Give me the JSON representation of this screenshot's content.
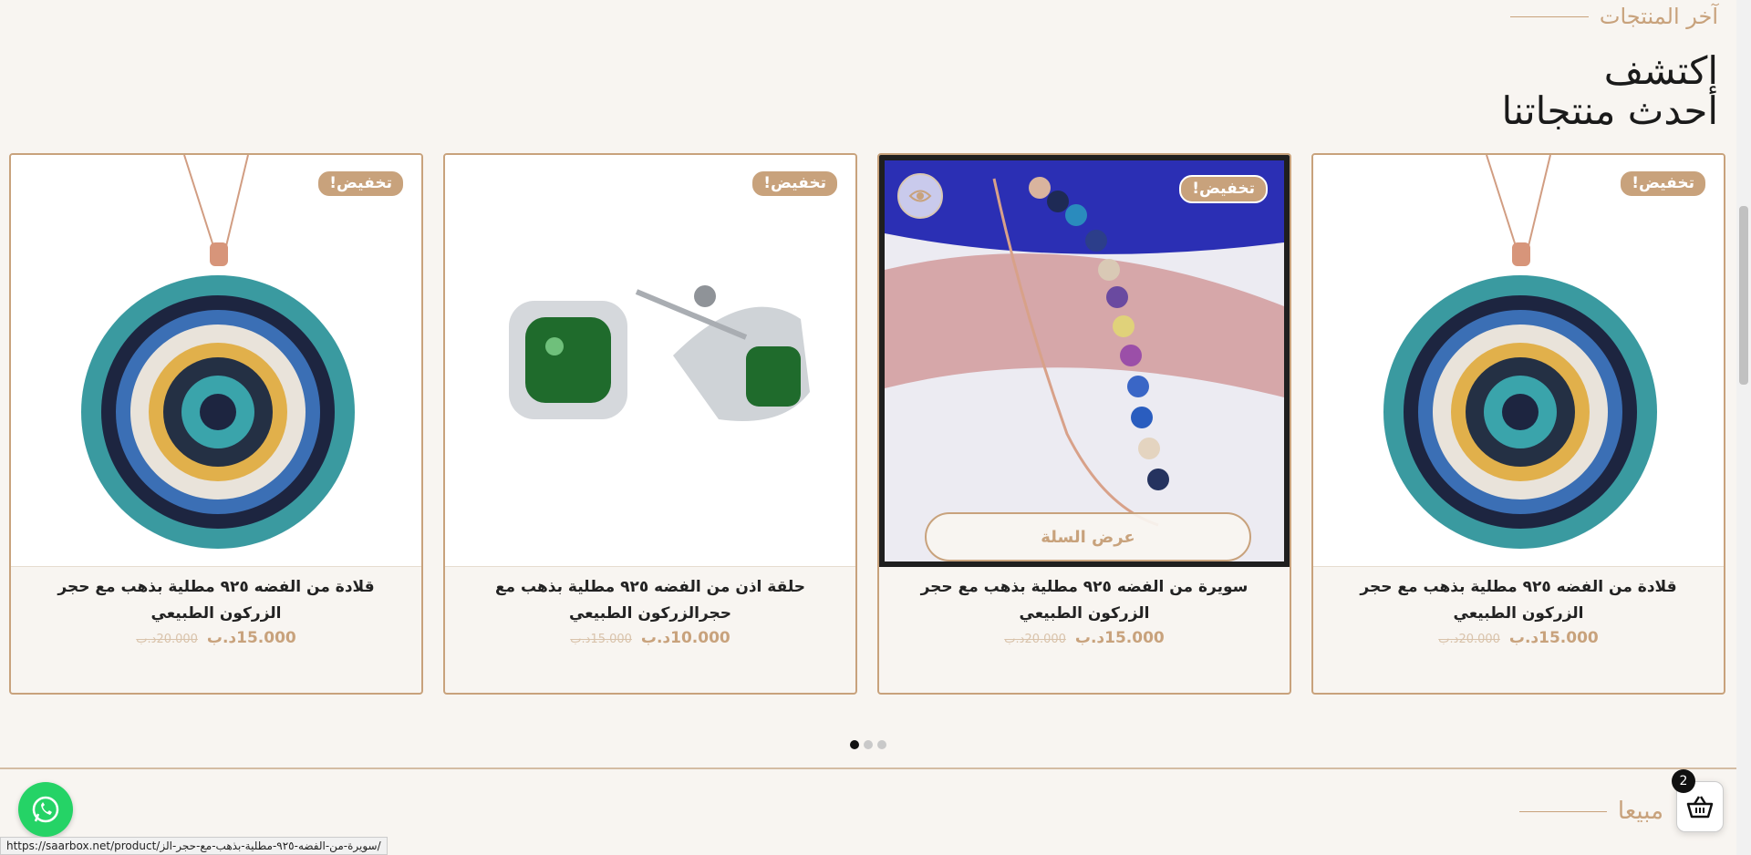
{
  "section": {
    "eyebrow": "آخر المنتجات",
    "headline_line1": "اكتشف",
    "headline_line2": "أحدث منتجاتنا"
  },
  "products": [
    {
      "title": "قلادة من الفضه ٩٢٥ مطلية بذهب مع حجر الزركون الطبيعي",
      "price": "15.000د.ب",
      "old_price": "20.000د.ب",
      "badge": "تخفيض!"
    },
    {
      "title": "حلقة اذن من الفضه ٩٢٥ مطلية بذهب مع حجرالزركون الطبيعي",
      "price": "10.000د.ب",
      "old_price": "15.000د.ب",
      "badge": "تخفيض!"
    },
    {
      "title": "سويرة من الفضه ٩٢٥ مطلية بذهب مع حجر الزركون الطبيعي",
      "price": "15.000د.ب",
      "old_price": "20.000د.ب",
      "badge": "تخفيض!",
      "cart_button": "عرض السلة"
    },
    {
      "title": "قلادة من الفضه ٩٢٥ مطلية بذهب مع حجر الزركون الطبيعي",
      "price": "15.000د.ب",
      "old_price": "20.000د.ب",
      "badge": "تخفيض!"
    }
  ],
  "carousel": {
    "pages": 3,
    "active": 1
  },
  "best_sellers": {
    "label": "مبيعا"
  },
  "cart": {
    "count": "2"
  },
  "status_bar": {
    "url": "https://saarbox.net/product/سويرة-من-الفضه-٩٢٥-مطلية-بذهب-مع-حجر-الز/"
  },
  "colors": {
    "accent": "#c8a27c",
    "background": "#f8f5f1",
    "whatsapp": "#25d366"
  },
  "icons": [
    "eye-icon",
    "whatsapp-icon",
    "basket-icon"
  ]
}
